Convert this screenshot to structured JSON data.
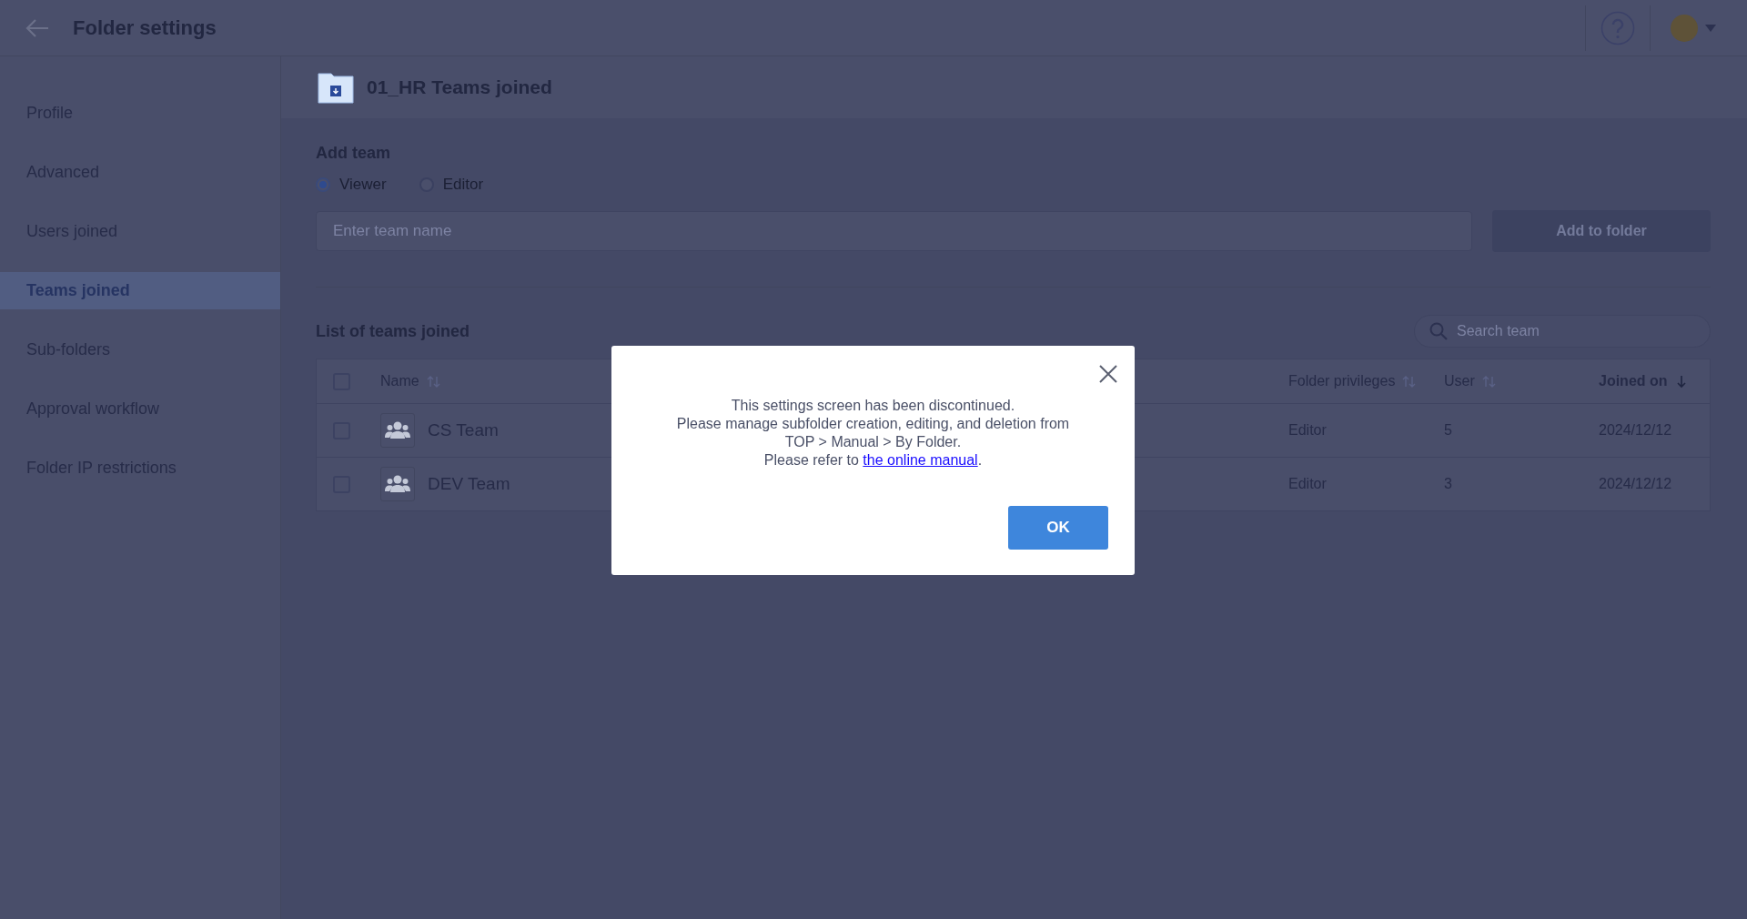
{
  "header": {
    "title": "Folder settings"
  },
  "sidebar": {
    "items": [
      {
        "label": "Profile",
        "selected": false
      },
      {
        "label": "Advanced",
        "selected": false
      },
      {
        "label": "Users joined",
        "selected": false
      },
      {
        "label": "Teams joined",
        "selected": true
      },
      {
        "label": "Sub-folders",
        "selected": false
      },
      {
        "label": "Approval workflow",
        "selected": false
      },
      {
        "label": "Folder IP restrictions",
        "selected": false
      }
    ]
  },
  "folder": {
    "title": "01_HR Teams joined"
  },
  "add_team": {
    "heading": "Add team",
    "roles": [
      {
        "label": "Viewer",
        "selected": true
      },
      {
        "label": "Editor",
        "selected": false
      }
    ],
    "input": {
      "placeholder": "Enter team name"
    },
    "button": {
      "label": "Add to folder",
      "disabled": true
    }
  },
  "list": {
    "heading": "List of teams joined",
    "search": {
      "placeholder": "Search team"
    },
    "select_all": {
      "checked": false
    },
    "columns": [
      {
        "label": "Name",
        "sorted": false
      },
      {
        "label": "Folder privileges",
        "sorted": false
      },
      {
        "label": "User",
        "sorted": false
      },
      {
        "label": "Joined on",
        "sorted": true
      }
    ],
    "rows": [
      {
        "checked": false,
        "name": "CS Team",
        "privilege": "Editor",
        "users": "5",
        "joined": "2024/12/12"
      },
      {
        "checked": false,
        "name": "DEV Team",
        "privilege": "Editor",
        "users": "3",
        "joined": "2024/12/12"
      }
    ]
  },
  "dialog": {
    "lines": [
      "This settings screen has been discontinued.",
      "Please manage subfolder creation, editing, and deletion from",
      "TOP > Manual > By Folder."
    ],
    "refer_prefix": "Please refer to ",
    "link": "the online manual",
    "refer_suffix": ".",
    "ok": "OK"
  }
}
